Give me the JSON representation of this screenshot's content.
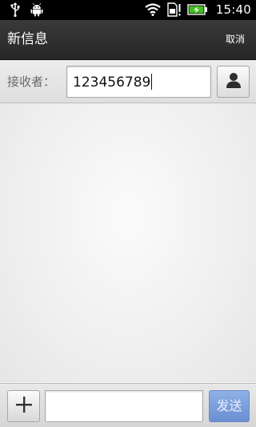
{
  "status_bar": {
    "time": "15:40",
    "left_icons": [
      "usb-icon",
      "android-debug-icon"
    ],
    "right_icons": [
      "wifi-icon",
      "sim-alert-icon",
      "battery-charging-icon"
    ],
    "battery_color": "#3ec11c"
  },
  "header": {
    "title": "新信息",
    "cancel_label": "取消"
  },
  "recipient": {
    "label": "接收者：",
    "value": "123456789",
    "contact_button_icon": "contact-person-icon"
  },
  "compose": {
    "attach_icon": "plus-icon",
    "message_value": "",
    "send_label": "发送",
    "send_color": "#7c9edb"
  }
}
